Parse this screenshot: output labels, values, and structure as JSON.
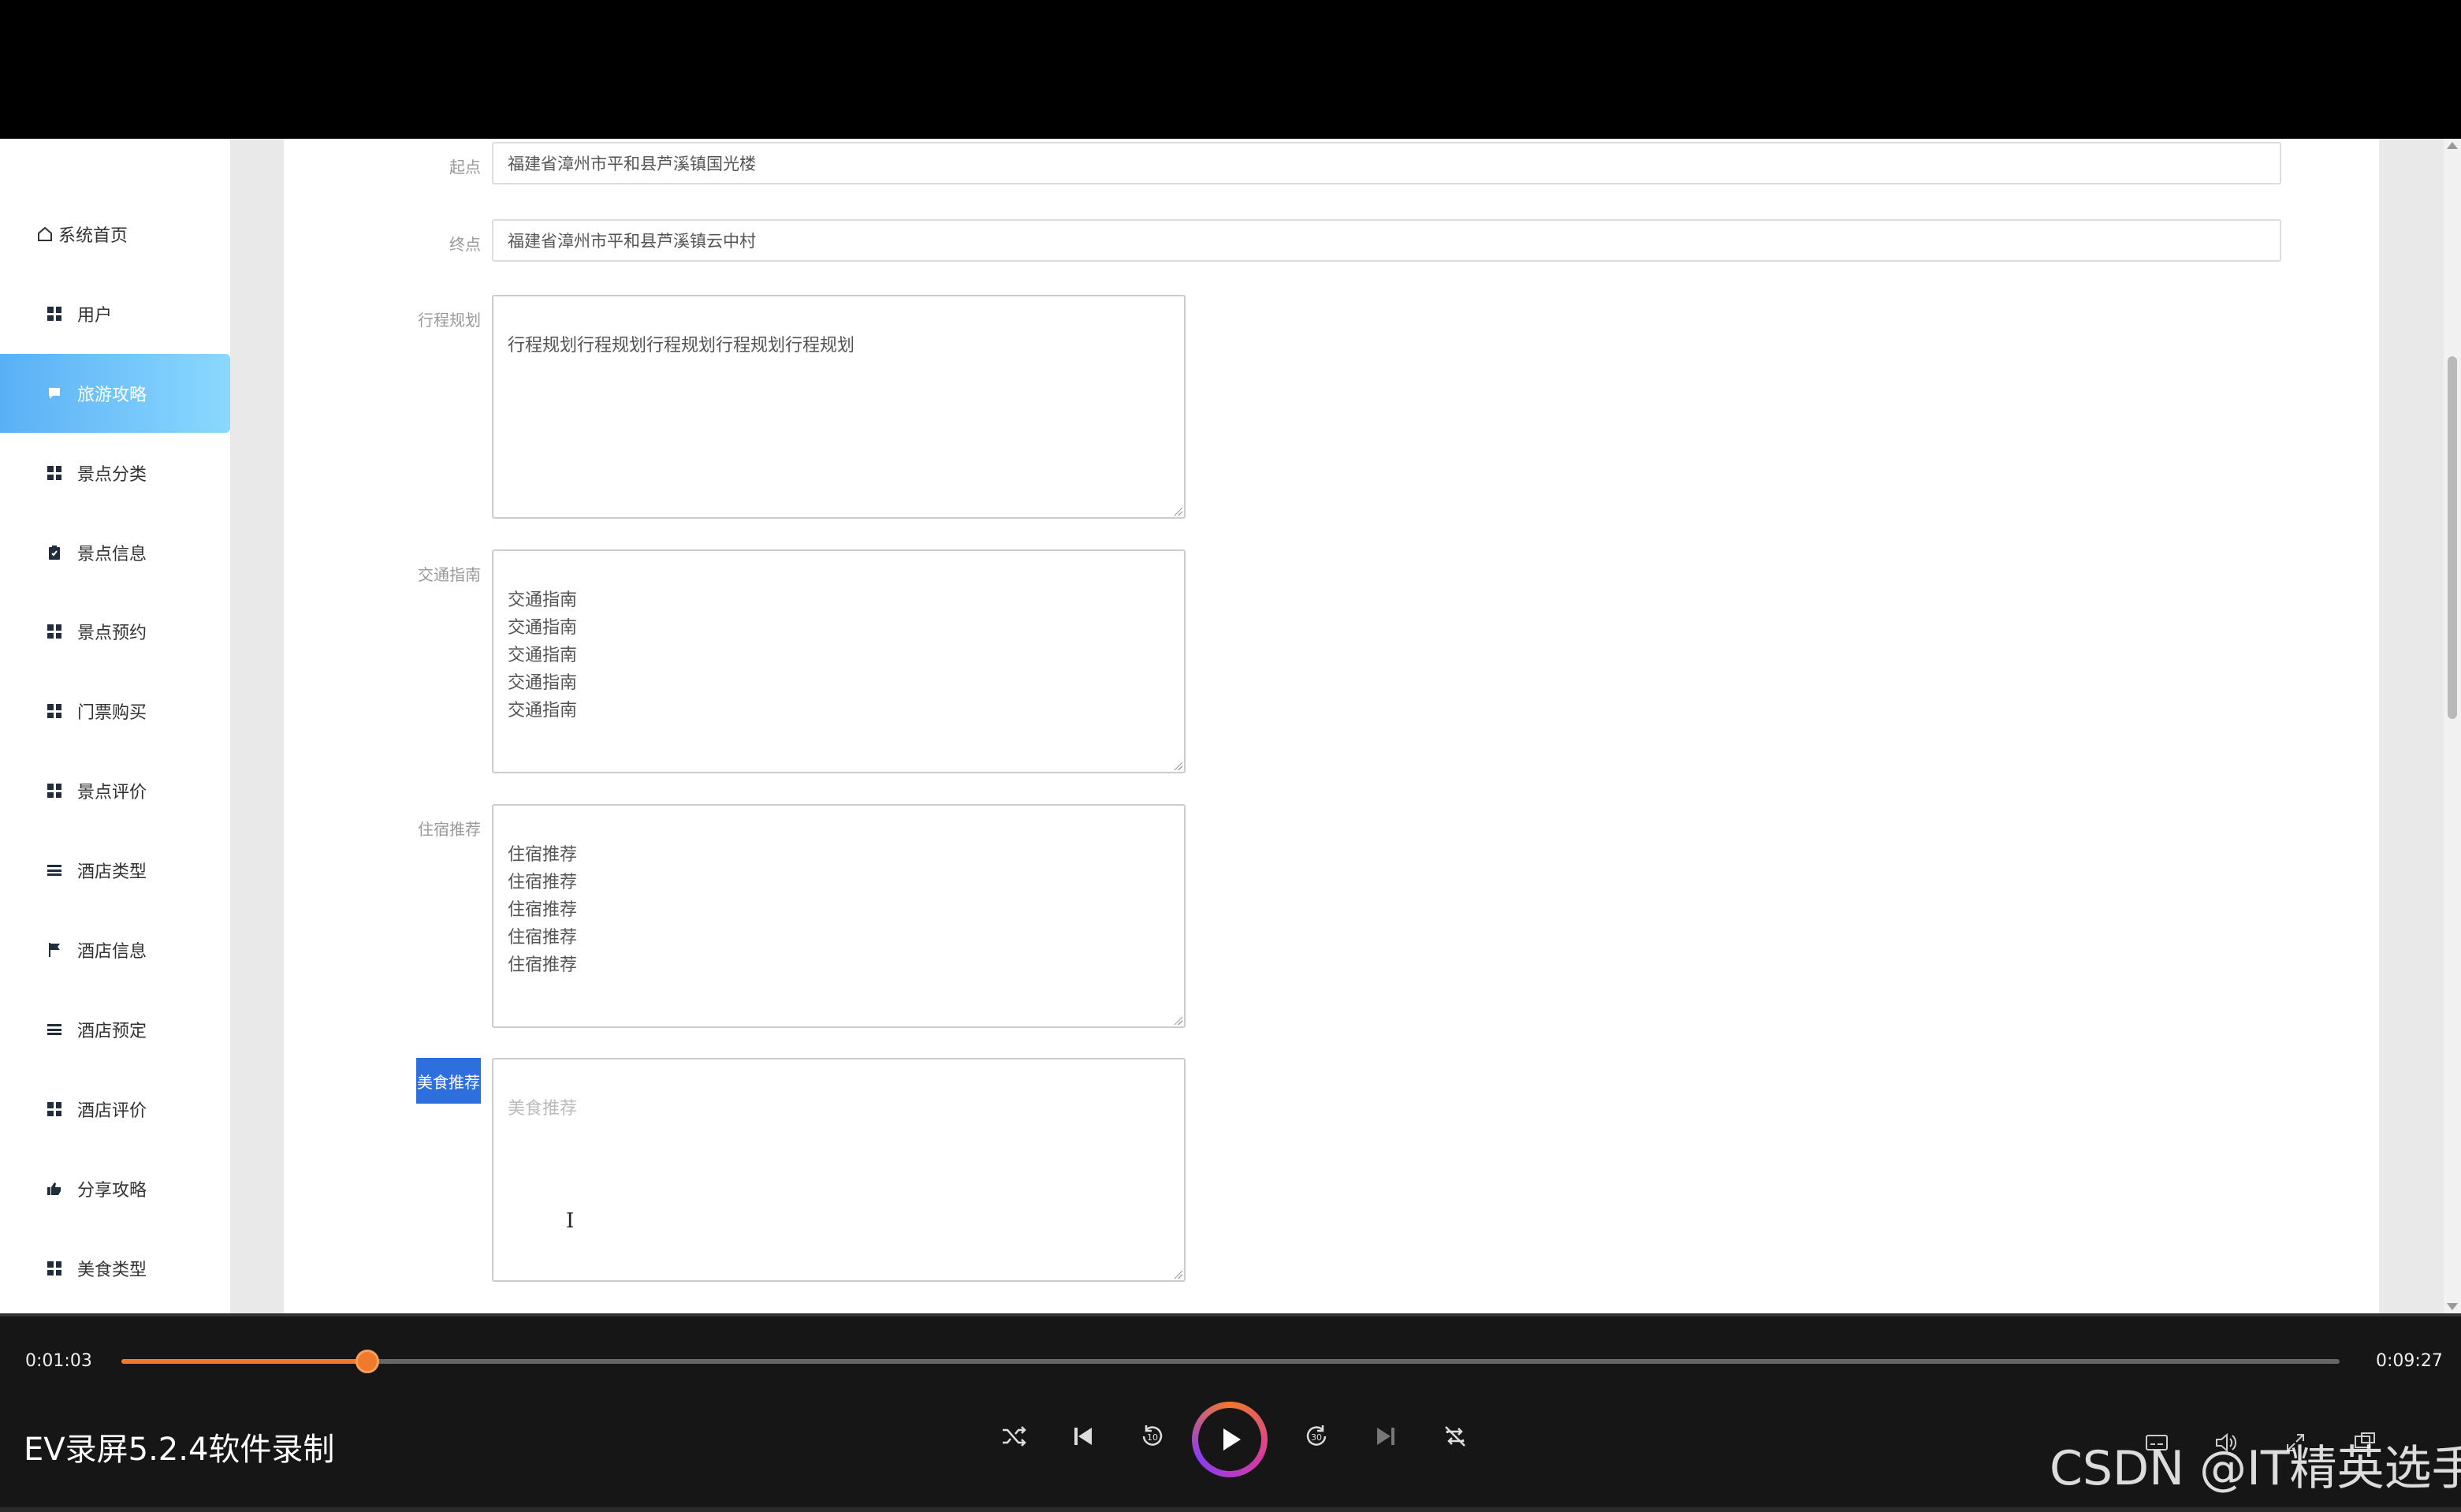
{
  "sidebar": {
    "items": [
      {
        "label": "系统首页",
        "icon": "home-icon"
      },
      {
        "label": "用户",
        "icon": "grid-icon"
      },
      {
        "label": "旅游攻略",
        "icon": "chat-icon",
        "active": true
      },
      {
        "label": "景点分类",
        "icon": "grid-icon"
      },
      {
        "label": "景点信息",
        "icon": "clipboard-icon"
      },
      {
        "label": "景点预约",
        "icon": "grid-icon"
      },
      {
        "label": "门票购买",
        "icon": "grid-icon"
      },
      {
        "label": "景点评价",
        "icon": "grid-icon"
      },
      {
        "label": "酒店类型",
        "icon": "list-icon"
      },
      {
        "label": "酒店信息",
        "icon": "flag-icon"
      },
      {
        "label": "酒店预定",
        "icon": "list-icon"
      },
      {
        "label": "酒店评价",
        "icon": "grid-icon"
      },
      {
        "label": "分享攻略",
        "icon": "thumbs-up-icon"
      },
      {
        "label": "美食类型",
        "icon": "grid-icon"
      }
    ]
  },
  "form": {
    "start": {
      "label": "起点",
      "value": "福建省漳州市平和县芦溪镇国光楼"
    },
    "end": {
      "label": "终点",
      "value": "福建省漳州市平和县芦溪镇云中村"
    },
    "itinerary": {
      "label": "行程规划",
      "value": "行程规划行程规划行程规划行程规划行程规划"
    },
    "transport": {
      "label": "交通指南",
      "value": "交通指南\n交通指南\n交通指南\n交通指南\n交通指南"
    },
    "lodging": {
      "label": "住宿推荐",
      "value": "住宿推荐\n住宿推荐\n住宿推荐\n住宿推荐\n住宿推荐"
    },
    "food": {
      "label": "美食推荐",
      "placeholder": "美食推荐"
    }
  },
  "player": {
    "current_time": "0:01:03",
    "total_time": "0:09:27",
    "progress_fraction": 0.111,
    "title": "EV录屏5.2.4软件录制",
    "skip_back_seconds": "10",
    "skip_forward_seconds": "30",
    "accent_color": "#f07a2c"
  },
  "watermark": "CSDN @IT精英选手"
}
